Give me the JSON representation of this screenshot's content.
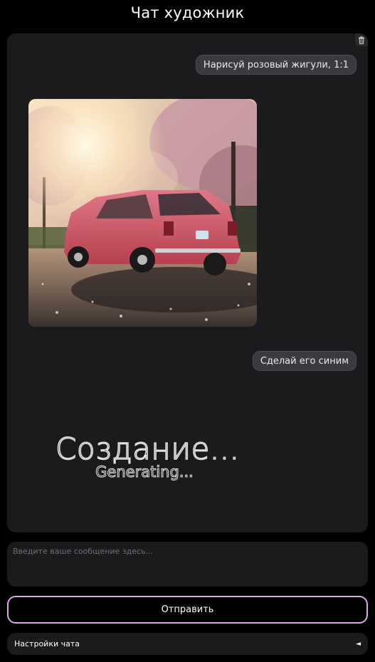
{
  "header": {
    "title": "Чат художник"
  },
  "chat": {
    "messages": [
      {
        "role": "user",
        "text": "Нарисуй розовый жигули, 1:1"
      },
      {
        "role": "assistant",
        "type": "image",
        "alt": "pink car under cherry blossoms"
      },
      {
        "role": "user",
        "text": "Сделай его синим"
      }
    ],
    "status": {
      "title": "Создание...",
      "subtitle": "Generating..."
    }
  },
  "input": {
    "placeholder": "Введите ваше сообщение здесь...",
    "value": ""
  },
  "send_button": {
    "label": "Отправить"
  },
  "settings": {
    "label": "Настройки чата",
    "caret": "◄"
  },
  "colors": {
    "background": "#000000",
    "panel": "#1b1b1d",
    "bubble": "#3b3b3f",
    "accent_border": "#d7a8e4",
    "car": "#d35a6a"
  },
  "icons": {
    "clear_chat": "trash-icon",
    "settings_toggle": "caret-left-icon"
  }
}
